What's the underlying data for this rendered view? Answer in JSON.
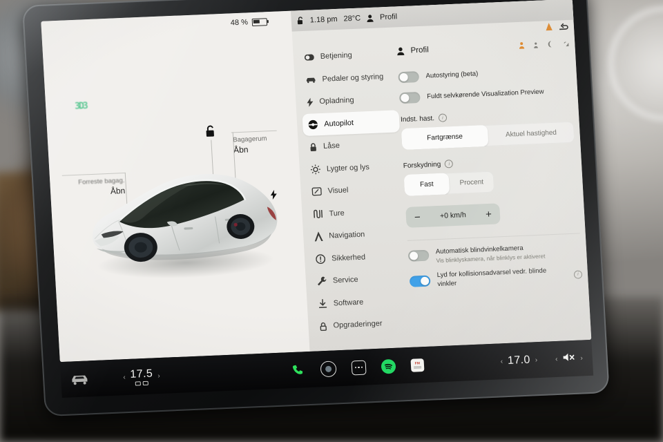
{
  "status_bar": {
    "battery_percent": "48 %",
    "battery_level": 48,
    "lock_icon": "unlock-icon",
    "time": "1.18 pm",
    "outside_temp": "28°C",
    "profile_icon": "person-icon",
    "profile_label": "Profil",
    "warning_icon": "orange-warning-icon",
    "seat_icon": "seat-icon"
  },
  "car_view": {
    "logo": "3D3",
    "lock_state_icon": "unlocked-padlock-icon",
    "charge_icon": "charge-bolt-icon",
    "trunk": {
      "title": "Bagagerum",
      "action": "Åbn"
    },
    "frunk": {
      "title": "Forreste bagag.",
      "action": "Åbn"
    },
    "vehicle": "tesla-model-3-white"
  },
  "menu": {
    "items": [
      {
        "label": "Betjening",
        "icon": "toggle-icon",
        "active": false
      },
      {
        "label": "Pedaler og styring",
        "icon": "car-front-icon",
        "active": false
      },
      {
        "label": "Opladning",
        "icon": "bolt-icon",
        "active": false
      },
      {
        "label": "Autopilot",
        "icon": "steering-wheel-icon",
        "active": true
      },
      {
        "label": "Låse",
        "icon": "lock-icon",
        "active": false
      },
      {
        "label": "Lygter og lys",
        "icon": "sun-icon",
        "active": false
      },
      {
        "label": "Visuel",
        "icon": "display-icon",
        "active": false
      },
      {
        "label": "Ture",
        "icon": "trips-icon",
        "active": false
      },
      {
        "label": "Navigation",
        "icon": "navigation-arrow-icon",
        "active": false
      },
      {
        "label": "Sikkerhed",
        "icon": "alert-circle-icon",
        "active": false
      },
      {
        "label": "Service",
        "icon": "wrench-icon",
        "active": false
      },
      {
        "label": "Software",
        "icon": "download-icon",
        "active": false
      },
      {
        "label": "Opgraderinger",
        "icon": "upgrade-lock-icon",
        "active": false
      }
    ]
  },
  "panel": {
    "header": {
      "icon": "person-icon",
      "title": "Profil"
    },
    "status_icons": [
      "orange-person-icon",
      "person-icon",
      "moon-icon",
      "signal-icon"
    ],
    "toggles_top": [
      {
        "label": "Autostyring (beta)",
        "on": false
      },
      {
        "label": "Fuldt selvkørende Visualization Preview",
        "on": false
      }
    ],
    "speed_setting": {
      "label": "Indst. hast.",
      "info_icon": "info-icon",
      "options": [
        "Fartgrænse",
        "Aktuel hastighed"
      ],
      "selected": "Fartgrænse"
    },
    "offset_setting": {
      "label": "Forskydning",
      "info_icon": "info-icon",
      "options": [
        "Fast",
        "Procent"
      ],
      "selected": "Fast"
    },
    "stepper": {
      "minus": "−",
      "value": "+0 km/h",
      "plus": "+"
    },
    "toggles_bottom": [
      {
        "label": "Automatisk blindvinkelkamera",
        "sub": "Vis blinklyskamera, når blinklys er aktiveret",
        "on": false,
        "info": false
      },
      {
        "label": "Lyd for kollisionsadvarsel vedr. blinde vinkler",
        "sub": "",
        "on": true,
        "info": true
      }
    ]
  },
  "dock": {
    "left_temp": {
      "value": "17.5",
      "left_arrow": "‹",
      "right_arrow": "›"
    },
    "car_icon": "car-front-icon",
    "apps": [
      {
        "name": "phone-icon",
        "label": "Telefon"
      },
      {
        "name": "camera-icon",
        "label": "Kamera"
      },
      {
        "name": "apps-grid-icon",
        "label": "Apps"
      },
      {
        "name": "spotify-icon",
        "label": "Spotify"
      },
      {
        "name": "fm-radio-icon",
        "label": "FM"
      }
    ],
    "right_temp": {
      "value": "17.0",
      "left_arrow": "‹",
      "right_arrow": "›"
    },
    "volume": {
      "icon": "mute-icon",
      "state": "muted",
      "left_arrow": "‹",
      "right_arrow": "›"
    }
  },
  "colors": {
    "accent_blue": "#3fa0e8",
    "spotify_green": "#1ed760",
    "warning_orange": "#e08a2e",
    "screen_bg": "#eceae6",
    "panel_bg": "#e4e3df"
  }
}
